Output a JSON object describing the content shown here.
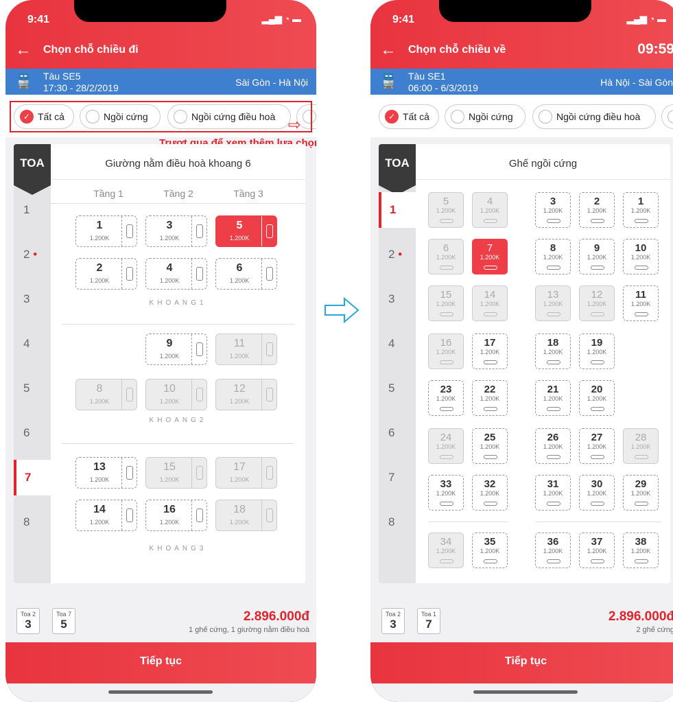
{
  "status_time": "9:41",
  "hint": "Trượt qua để xem thêm lựa chọn",
  "continue": "Tiếp tục",
  "left": {
    "title": "Chọn chỗ chiều đi",
    "train_name": "Tàu SE5",
    "train_datetime": "17:30 - 28/2/2019",
    "route": "Sài Gòn - Hà Nội",
    "filters": [
      "Tất cả",
      "Ngồi cứng",
      "Ngồi cứng điều hoà"
    ],
    "toa_label": "TOA",
    "cars": [
      "1",
      "2",
      "3",
      "4",
      "5",
      "6",
      "7",
      "8"
    ],
    "selected_car": "7",
    "coach_title": "Giường nằm điều hoà khoang 6",
    "tiers": [
      "Tầng 1",
      "Tầng 2",
      "Tầng 3"
    ],
    "compartments": [
      "KHOANG1",
      "KHOANG2",
      "KHOANG3"
    ],
    "beds": [
      {
        "n": "1",
        "p": "1.200K",
        "s": "avail"
      },
      {
        "n": "3",
        "p": "1.200K",
        "s": "avail"
      },
      {
        "n": "5",
        "p": "1.200K",
        "s": "selected"
      },
      {
        "n": "2",
        "p": "1.200K",
        "s": "avail"
      },
      {
        "n": "4",
        "p": "1.200K",
        "s": "avail"
      },
      {
        "n": "6",
        "p": "1.200K",
        "s": "avail"
      },
      {
        "n": "9",
        "p": "1.200K",
        "s": "avail"
      },
      {
        "n": "11",
        "p": "1.200K",
        "s": "taken"
      },
      {
        "n": "8",
        "p": "1.200K",
        "s": "taken"
      },
      {
        "n": "10",
        "p": "1.200K",
        "s": "taken"
      },
      {
        "n": "12",
        "p": "1.200K",
        "s": "taken"
      },
      {
        "n": "13",
        "p": "1.200K",
        "s": "avail"
      },
      {
        "n": "15",
        "p": "1.200K",
        "s": "taken"
      },
      {
        "n": "17",
        "p": "1.200K",
        "s": "taken"
      },
      {
        "n": "14",
        "p": "1.200K",
        "s": "avail"
      },
      {
        "n": "16",
        "p": "1.200K",
        "s": "avail"
      },
      {
        "n": "18",
        "p": "1.200K",
        "s": "taken"
      }
    ],
    "chips": [
      {
        "label": "Toa 2",
        "value": "3"
      },
      {
        "label": "Toa 7",
        "value": "5"
      }
    ],
    "total": "2.896.000đ",
    "summary": "1 ghế cứng, 1 giường nằm điều hoà"
  },
  "right": {
    "title": "Chọn chỗ chiều về",
    "timer": "09:59",
    "train_name": "Tàu SE1",
    "train_datetime": "06:00 - 6/3/2019",
    "route": "Hà Nội - Sài Gòn",
    "filters": [
      "Tất cả",
      "Ngồi cứng",
      "Ngồi cứng điều hoà"
    ],
    "toa_label": "TOA",
    "cars": [
      "1",
      "2",
      "3",
      "4",
      "5",
      "6",
      "7",
      "8"
    ],
    "selected_car": "1",
    "coach_title": "Ghế ngồi cứng",
    "seats": [
      {
        "n": "5",
        "p": "1.200K",
        "s": "taken"
      },
      {
        "n": "4",
        "p": "1.200K",
        "s": "taken"
      },
      {
        "n": "3",
        "p": "1.200K",
        "s": "avail"
      },
      {
        "n": "2",
        "p": "1.200K",
        "s": "avail"
      },
      {
        "n": "1",
        "p": "1.200K",
        "s": "avail"
      },
      {
        "n": "6",
        "p": "1.200K",
        "s": "taken"
      },
      {
        "n": "7",
        "p": "1.200K",
        "s": "selected"
      },
      {
        "n": "8",
        "p": "1.200K",
        "s": "avail"
      },
      {
        "n": "9",
        "p": "1.200K",
        "s": "avail"
      },
      {
        "n": "10",
        "p": "1.200K",
        "s": "avail"
      },
      {
        "n": "15",
        "p": "1.200K",
        "s": "taken"
      },
      {
        "n": "14",
        "p": "1.200K",
        "s": "taken"
      },
      {
        "n": "13",
        "p": "1.200K",
        "s": "taken"
      },
      {
        "n": "12",
        "p": "1.200K",
        "s": "taken"
      },
      {
        "n": "11",
        "p": "1.200K",
        "s": "avail"
      },
      {
        "n": "16",
        "p": "1.200K",
        "s": "taken"
      },
      {
        "n": "17",
        "p": "1.200K",
        "s": "avail"
      },
      {
        "n": "18",
        "p": "1.200K",
        "s": "avail"
      },
      {
        "n": "19",
        "p": "1.200K",
        "s": "avail"
      },
      {
        "n": "23",
        "p": "1.200K",
        "s": "avail"
      },
      {
        "n": "22",
        "p": "1.200K",
        "s": "avail"
      },
      {
        "n": "21",
        "p": "1.200K",
        "s": "avail"
      },
      {
        "n": "20",
        "p": "1.200K",
        "s": "avail"
      },
      {
        "n": "24",
        "p": "1.200K",
        "s": "taken"
      },
      {
        "n": "25",
        "p": "1.200K",
        "s": "avail"
      },
      {
        "n": "26",
        "p": "1.200K",
        "s": "avail"
      },
      {
        "n": "27",
        "p": "1.200K",
        "s": "avail"
      },
      {
        "n": "28",
        "p": "1.200K",
        "s": "taken"
      },
      {
        "n": "33",
        "p": "1.200K",
        "s": "avail"
      },
      {
        "n": "32",
        "p": "1.200K",
        "s": "avail"
      },
      {
        "n": "31",
        "p": "1.200K",
        "s": "avail"
      },
      {
        "n": "30",
        "p": "1.200K",
        "s": "avail"
      },
      {
        "n": "29",
        "p": "1.200K",
        "s": "avail"
      },
      {
        "n": "34",
        "p": "1.200K",
        "s": "taken"
      },
      {
        "n": "35",
        "p": "1.200K",
        "s": "avail"
      },
      {
        "n": "36",
        "p": "1.200K",
        "s": "avail"
      },
      {
        "n": "37",
        "p": "1.200K",
        "s": "avail"
      },
      {
        "n": "38",
        "p": "1.200K",
        "s": "avail"
      }
    ],
    "chips": [
      {
        "label": "Toa 2",
        "value": "3"
      },
      {
        "label": "Toa 1",
        "value": "7"
      }
    ],
    "total": "2.896.000đ",
    "summary": "2 ghế cứng"
  }
}
